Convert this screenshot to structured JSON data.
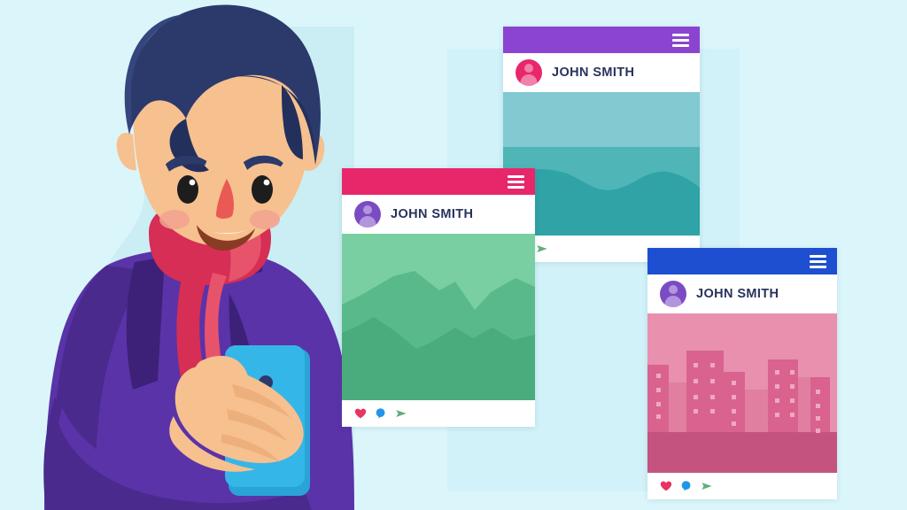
{
  "scene": {
    "title": "Man holding smartphone with social media post cards",
    "background_color": "#dbf6fb",
    "panel_color": "#cdf0f7",
    "silhouette_color": "#cbeef5"
  },
  "person": {
    "name": "man-with-phone",
    "hair_color": "#2b3a6b",
    "hair_shadow_color": "#23305c",
    "hair_highlight_color": "#35457d",
    "skin_color": "#f7c08f",
    "skin_shadow_color": "#edb07c",
    "cheek_color": "#f2a191",
    "nose_color": "#ea5a55",
    "eye_color": "#1d1d1d",
    "brow_color": "#2b3a6b",
    "mouth_color": "#8a3b23",
    "teeth_color": "#ffffff",
    "scarf_color": "#d62e54",
    "scarf_shadow_color": "#e8536c",
    "coat_color": "#5a33a8",
    "coat_shadow_color": "#4a2a8d",
    "coat_dark_color": "#3d2178",
    "phone_color": "#35b6e8",
    "phone_shadow_color": "#2aa3d6",
    "phone_camera_color": "#2b3a6b"
  },
  "icons": {
    "hamburger": "hamburger-menu-icon",
    "like": "heart-icon",
    "comment": "comment-bubble-icon",
    "share": "send-arrow-icon",
    "avatar": "user-avatar-icon",
    "like_color": "#e8345e",
    "comment_color": "#2196e8",
    "share_color": "#5fae7f"
  },
  "cards": [
    {
      "id": "card-purple",
      "bar_color": "#8b44cf",
      "avatar_color": "#e8276b",
      "username": "JOHN SMITH",
      "media": {
        "type": "teal-wave-photo",
        "sky_color": "#82c9d1",
        "mid_color": "#4fb5b7",
        "wave_color": "#2fa3a6"
      },
      "actions": [
        "comment-bubble-icon",
        "send-arrow-icon"
      ]
    },
    {
      "id": "card-pink",
      "bar_color": "#e8276b",
      "avatar_color": "#7b4bc4",
      "username": "JOHN SMITH",
      "media": {
        "type": "green-mountain-photo",
        "sky_color": "#79cfa1",
        "mid_color": "#59b98a",
        "front_color": "#4aab7c"
      },
      "actions": [
        "heart-icon",
        "comment-bubble-icon",
        "send-arrow-icon"
      ]
    },
    {
      "id": "card-blue",
      "bar_color": "#1e4fd1",
      "avatar_color": "#7b4bc4",
      "username": "JOHN SMITH",
      "media": {
        "type": "pink-cityscape-photo",
        "sky_color": "#e890ae",
        "building_color": "#d9628f",
        "building_dark_color": "#cf5686",
        "ground_color": "#c4547f",
        "window_color": "#f0a8c2"
      },
      "actions": [
        "heart-icon",
        "comment-bubble-icon",
        "send-arrow-icon"
      ]
    }
  ]
}
